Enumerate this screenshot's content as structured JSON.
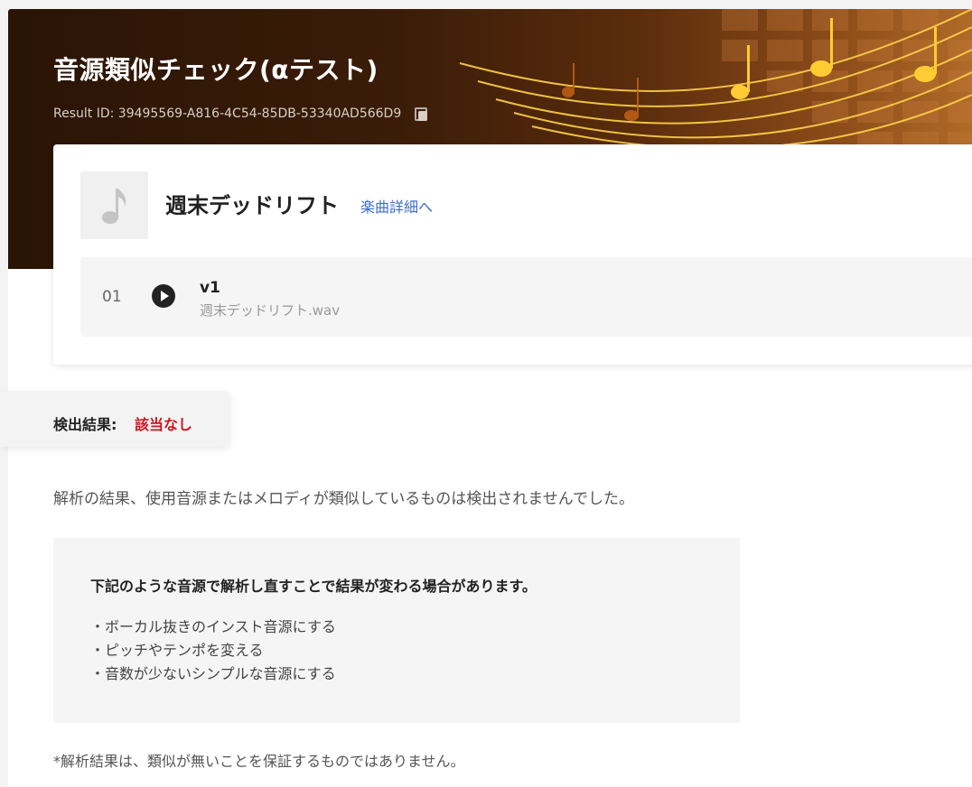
{
  "header": {
    "title": "音源類似チェック(αテスト)",
    "result_id": "Result ID: 39495569-A816-4C54-85DB-53340AD566D9"
  },
  "song": {
    "title": "週末デッドリフト",
    "detail_link": "楽曲詳細へ",
    "tracks": [
      {
        "number": "01",
        "name": "v1",
        "file": "週末デッドリフト.wav"
      }
    ]
  },
  "result": {
    "label": "検出結果:",
    "value": "該当なし",
    "value_color": "#d0141c",
    "message": "解析の結果、使用音源またはメロディが類似しているものは検出されませんでした。"
  },
  "tips": {
    "heading": "下記のような音源で解析し直すことで結果が変わる場合があります。",
    "items": [
      "・ボーカル抜きのインスト音源にする",
      "・ピッチやテンポを変える",
      "・音数が少ないシンプルな音源にする"
    ]
  },
  "footnote": "*解析結果は、類似が無いことを保証するものではありません。",
  "colors": {
    "link": "#3a6ec8",
    "hero_dark": "#2a1405",
    "hero_light": "#b06a28"
  },
  "icons": {
    "copy": "copy-icon",
    "play": "play-icon",
    "music_note": "music-note-icon"
  }
}
